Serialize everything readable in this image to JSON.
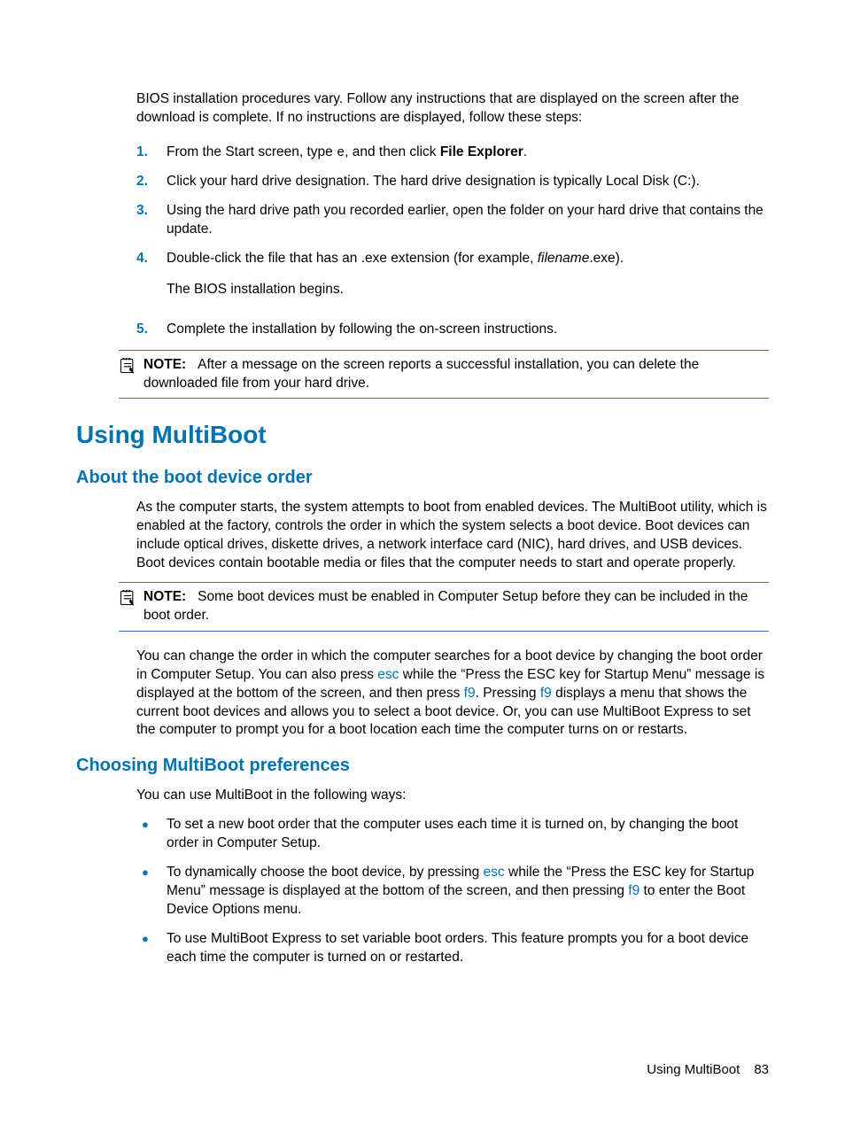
{
  "intro": "BIOS installation procedures vary. Follow any instructions that are displayed on the screen after the download is complete. If no instructions are displayed, follow these steps:",
  "steps": [
    {
      "n": "1.",
      "pre": "From the Start screen, type ",
      "typed": "e",
      "mid": ", and then click ",
      "bold": "File Explorer",
      "post": "."
    },
    {
      "n": "2.",
      "text": "Click your hard drive designation. The hard drive designation is typically Local Disk (C:)."
    },
    {
      "n": "3.",
      "text": "Using the hard drive path you recorded earlier, open the folder on your hard drive that contains the update."
    },
    {
      "n": "4.",
      "pre": "Double-click the file that has an .exe extension (for example, ",
      "italic": "filename",
      "post": ".exe).",
      "followup": "The BIOS installation begins."
    },
    {
      "n": "5.",
      "text": "Complete the installation by following the on-screen instructions."
    }
  ],
  "note1_label": "NOTE:",
  "note1_text": "After a message on the screen reports a successful installation, you can delete the downloaded file from your hard drive.",
  "h1": "Using MultiBoot",
  "h2a": "About the boot device order",
  "para_a": "As the computer starts, the system attempts to boot from enabled devices. The MultiBoot utility, which is enabled at the factory, controls the order in which the system selects a boot device. Boot devices can include optical drives, diskette drives, a network interface card (NIC), hard drives, and USB devices. Boot devices contain bootable media or files that the computer needs to start and operate properly.",
  "note2_label": "NOTE:",
  "note2_text": "Some boot devices must be enabled in Computer Setup before they can be included in the boot order.",
  "para_b_1": "You can change the order in which the computer searches for a boot device by changing the boot order in Computer Setup. You can also press ",
  "key_esc": "esc",
  "para_b_2": " while the “Press the ESC key for Startup Menu” message is displayed at the bottom of the screen, and then press ",
  "key_f9": "f9",
  "para_b_3": ". Pressing ",
  "para_b_4": " displays a menu that shows the current boot devices and allows you to select a boot device. Or, you can use MultiBoot Express to set the computer to prompt you for a boot location each time the computer turns on or restarts.",
  "h2b": "Choosing MultiBoot preferences",
  "para_c": "You can use MultiBoot in the following ways:",
  "bullets": [
    {
      "text": "To set a new boot order that the computer uses each time it is turned on, by changing the boot order in Computer Setup."
    },
    {
      "pre": "To dynamically choose the boot device, by pressing ",
      "k1": "esc",
      "mid": " while the “Press the ESC key for Startup Menu” message is displayed at the bottom of the screen, and then pressing ",
      "k2": "f9",
      "post": " to enter the Boot Device Options menu."
    },
    {
      "text": "To use MultiBoot Express to set variable boot orders. This feature prompts you for a boot device each time the computer is turned on or restarted."
    }
  ],
  "footer_title": "Using MultiBoot",
  "footer_page": "83"
}
